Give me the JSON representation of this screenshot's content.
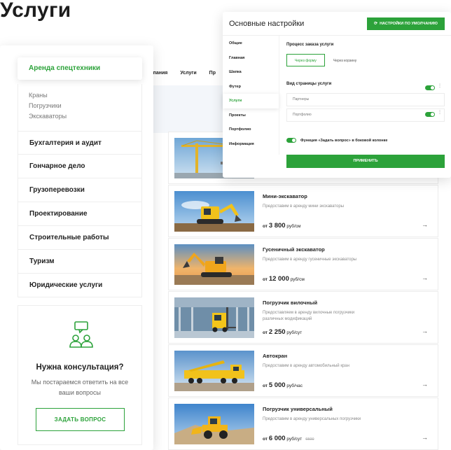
{
  "page": {
    "title": "Услуги"
  },
  "site_nav": {
    "items": [
      "Компания",
      "Услуги",
      "Пр"
    ]
  },
  "sidebar": {
    "active_label": "Аренда спецтехники",
    "subitems": [
      "Краны",
      "Погрузчики",
      "Экскаваторы"
    ],
    "items": [
      "Бухгалтерия и аудит",
      "Гончарное дело",
      "Грузоперевозки",
      "Проектирование",
      "Строительные работы",
      "Туризм",
      "Юридические услуги"
    ],
    "consult": {
      "title": "Нужна консультация?",
      "text": "Мы постараемся ответить на все ваши вопросы",
      "button": "ЗАДАТЬ ВОПРОС",
      "icon": "consultation-icon"
    }
  },
  "products": [
    {
      "title": "",
      "desc": "",
      "from": "",
      "amount": "",
      "unit": "",
      "old": "",
      "image": "crane"
    },
    {
      "title": "Мини-экскаватор",
      "desc": "Предоставим в аренду мини экскаваторы",
      "from": "от",
      "amount": "3 800",
      "unit": "руб/см",
      "old": "",
      "image": "mini-excavator"
    },
    {
      "title": "Гусеничный экскаватор",
      "desc": "Предоставим в аренду гусеничные экскаваторы",
      "from": "от",
      "amount": "12 000",
      "unit": "руб/см",
      "old": "",
      "image": "excavator"
    },
    {
      "title": "Погрузчик вилочный",
      "desc": "Предоставляем в аренду вилочные погрузчики различных модификаций",
      "from": "от",
      "amount": "2 250",
      "unit": "руб/сут",
      "old": "",
      "image": "forklift"
    },
    {
      "title": "Автокран",
      "desc": "Предоставим в аренду автомобильный кран",
      "from": "от",
      "amount": "5 000",
      "unit": "руб/час",
      "old": "",
      "image": "truck-crane"
    },
    {
      "title": "Погрузчик универсальный",
      "desc": "Предоставим в аренду универсальных погрузчики",
      "from": "от",
      "amount": "6 000",
      "unit": "руб/сут",
      "old": "6500",
      "image": "loader"
    }
  ],
  "settings": {
    "title": "Основные настройки",
    "default_button": "НАСТРОЙКИ ПО УМОЛЧАНИЮ",
    "nav": [
      "Общие",
      "Главная",
      "Шапка",
      "Футер",
      "Услуги",
      "Проекты",
      "Портфолио",
      "Информация"
    ],
    "active_nav_index": 4,
    "order_process_label": "Процесс заказа услуги",
    "order_options": [
      "Через форму",
      "Через корзину"
    ],
    "order_selected_index": 0,
    "page_view_label": "Вид страницы услуги",
    "page_rows": [
      "Партнеры",
      "Портфолио"
    ],
    "function_label": "Функция «Задать вопрос» в боковой колонке",
    "apply_button": "ПРИМЕНИТЬ"
  },
  "colors": {
    "accent": "#2ca23a"
  }
}
